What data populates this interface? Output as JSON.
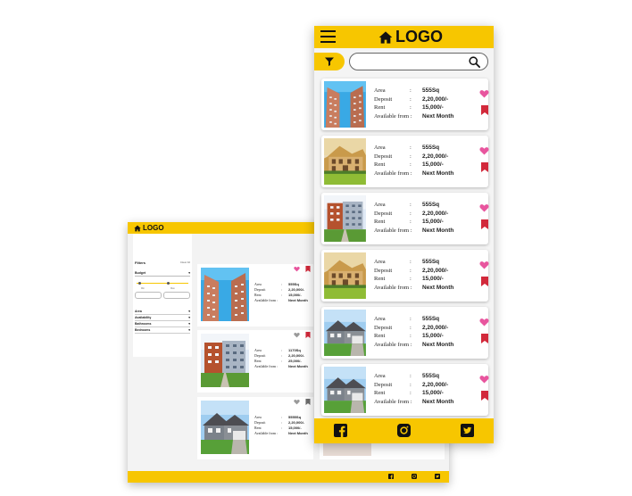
{
  "app": {
    "logo_text": "LOGO"
  },
  "colors": {
    "accent": "#f7c600",
    "heart_active": "#e8559e",
    "heart_inactive": "#9a9a9a",
    "bookmark": "#d2293b"
  },
  "desktop": {
    "filters": {
      "title": "Filters",
      "clear": "Clear All",
      "budget": "Budget",
      "min_label": "Min",
      "max_label": "Max",
      "sections": [
        "Area",
        "Availability",
        "Bathrooms",
        "Bedrooms"
      ]
    },
    "listings": [
      {
        "area": "555Sq",
        "deposit": "2,20,000/-",
        "rent": "15,000/-",
        "available": "Next Month",
        "liked": true
      },
      {
        "area": "1170Sq",
        "deposit": "2,20,000/-",
        "rent": "25,000/-",
        "available": "Next Month",
        "liked": false
      },
      {
        "area": "5555Sq",
        "deposit": "2,20,000/-",
        "rent": "15,000/-",
        "available": "Next Month",
        "liked": false
      }
    ]
  },
  "mobile": {
    "search_placeholder": "",
    "labels": {
      "area": "Area",
      "deposit": "Deposit",
      "rent": "Rent",
      "available": "Available from :",
      "colon": ":"
    },
    "listings": [
      {
        "area": "555Sq",
        "deposit": "2,20,000/-",
        "rent": "15,000/-",
        "available": "Next Month"
      },
      {
        "area": "555Sq",
        "deposit": "2,20,000/-",
        "rent": "15,000/-",
        "available": "Next Month"
      },
      {
        "area": "555Sq",
        "deposit": "2,20,000/-",
        "rent": "15,000/-",
        "available": "Next Month"
      },
      {
        "area": "555Sq",
        "deposit": "2,20,000/-",
        "rent": "15,000/-",
        "available": "Next Month"
      },
      {
        "area": "555Sq",
        "deposit": "2,20,000/-",
        "rent": "15,000/-",
        "available": "Next Month"
      },
      {
        "area": "555Sq",
        "deposit": "2,20,000/-",
        "rent": "15,000/-",
        "available": "Next Month"
      }
    ],
    "footer_icons": [
      "facebook-icon",
      "instagram-icon",
      "twitter-icon"
    ]
  }
}
